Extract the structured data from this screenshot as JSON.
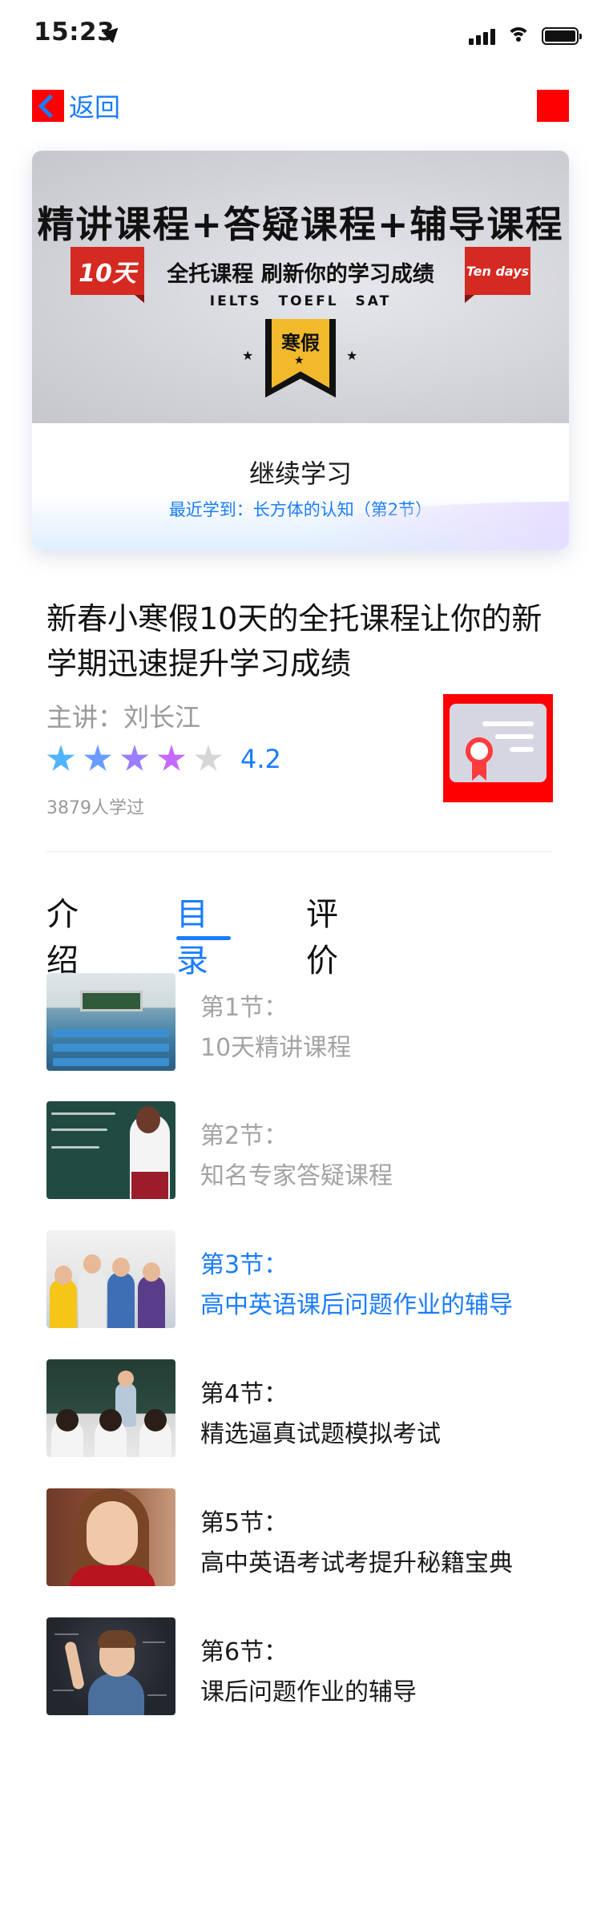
{
  "status_bar": {
    "time": "15:23"
  },
  "nav": {
    "back_label": "返回"
  },
  "banner": {
    "headline": "精讲课程+答疑课程+辅导课程",
    "ribbon_left": "10天",
    "ribbon_right": "Ten days",
    "subline": "全托课程 刷新你的学习成绩",
    "tags": "IELTS TOEFL SAT",
    "badge": "寒假",
    "continue_title": "继续学习",
    "recent": "最近学到：长方体的认知（第2节）"
  },
  "course": {
    "title": "新春小寒假10天的全托课程让你的新学期迅速提升学习成绩",
    "lecturer": "主讲：刘长江",
    "rating": "4.2",
    "rating_value": 4.2,
    "learners": "3879人学过"
  },
  "tabs": [
    {
      "label": "介绍"
    },
    {
      "label": "目录"
    },
    {
      "label": "评价"
    }
  ],
  "active_tab": "目录",
  "lessons": [
    {
      "num": "第1节：",
      "name": "10天精讲课程",
      "state": "done"
    },
    {
      "num": "第2节：",
      "name": "知名专家答疑课程",
      "state": "done"
    },
    {
      "num": "第3节：",
      "name": "高中英语课后问题作业的辅导",
      "state": "current"
    },
    {
      "num": "第4节：",
      "name": "精选逼真试题模拟考试",
      "state": "todo"
    },
    {
      "num": "第5节：",
      "name": "高中英语考试考提升秘籍宝典",
      "state": "todo"
    },
    {
      "num": "第6节：",
      "name": "课后问题作业的辅导",
      "state": "todo"
    }
  ],
  "colors": {
    "accent": "#1a7cff",
    "muted": "#a3a3a3",
    "star_colors": [
      "#4fb4ff",
      "#6a9cff",
      "#9b7dff",
      "#c46bff",
      "#d6d6d6"
    ]
  },
  "icons": {
    "back": "chevron-left-icon",
    "action": "share-icon",
    "certificate": "certificate-icon"
  }
}
